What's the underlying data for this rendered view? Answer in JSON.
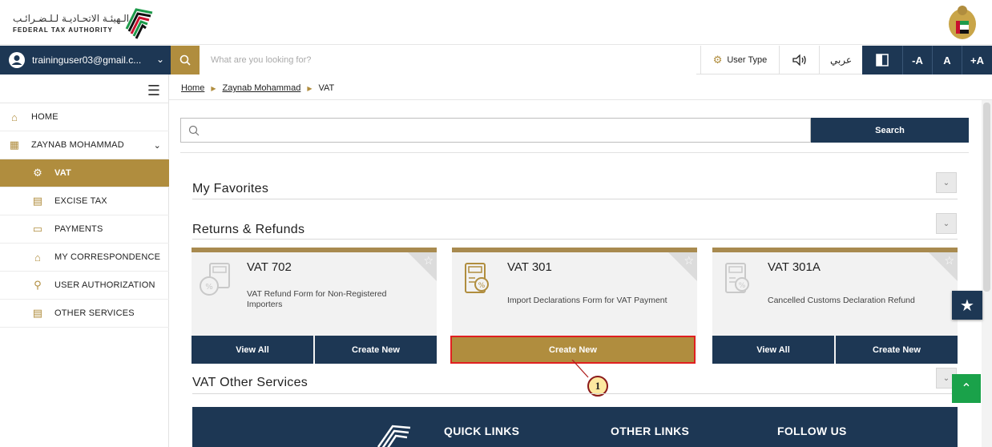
{
  "header": {
    "logo_ar": "الـهيئـة الاتحـاديـة لـلـضـرائـب",
    "logo_en": "FEDERAL TAX AUTHORITY"
  },
  "navbar": {
    "user_email": "traininguser03@gmail.c...",
    "search_placeholder": "What are you looking for?",
    "user_type": "User Type",
    "language": "عربي",
    "font_decrease": "-A",
    "font_normal": "A",
    "font_increase": "+A"
  },
  "sidebar": {
    "items": [
      {
        "label": "HOME",
        "icon": "home-icon"
      },
      {
        "label": "ZAYNAB MOHAMMAD",
        "icon": "grid-icon"
      },
      {
        "label": "VAT",
        "icon": "vat-icon"
      },
      {
        "label": "EXCISE TAX",
        "icon": "excise-icon"
      },
      {
        "label": "PAYMENTS",
        "icon": "card-icon"
      },
      {
        "label": "MY CORRESPONDENCE",
        "icon": "bank-icon"
      },
      {
        "label": "USER AUTHORIZATION",
        "icon": "user-key-icon"
      },
      {
        "label": "OTHER SERVICES",
        "icon": "document-icon"
      }
    ]
  },
  "breadcrumb": {
    "home": "Home",
    "user": "Zaynab Mohammad",
    "current": "VAT"
  },
  "main": {
    "search_button": "Search",
    "sections": {
      "favorites": "My Favorites",
      "returns": "Returns & Refunds",
      "other": "VAT Other Services"
    },
    "cards": [
      {
        "title": "VAT 702",
        "desc": "VAT Refund Form for Non-Registered Importers",
        "view_all": "View All",
        "create_new": "Create New"
      },
      {
        "title": "VAT 301",
        "desc": "Import Declarations Form for VAT Payment",
        "create_new": "Create New"
      },
      {
        "title": "VAT 301A",
        "desc": "Cancelled Customs Declaration Refund",
        "view_all": "View All",
        "create_new": "Create New"
      }
    ],
    "callout_number": "1"
  },
  "footer": {
    "quick_links": "QUICK LINKS",
    "other_links": "OTHER LINKS",
    "follow_us": "FOLLOW US"
  },
  "colors": {
    "navy": "#1d3754",
    "gold": "#b08d3e",
    "highlight": "#e02020",
    "green": "#1aa24a"
  }
}
